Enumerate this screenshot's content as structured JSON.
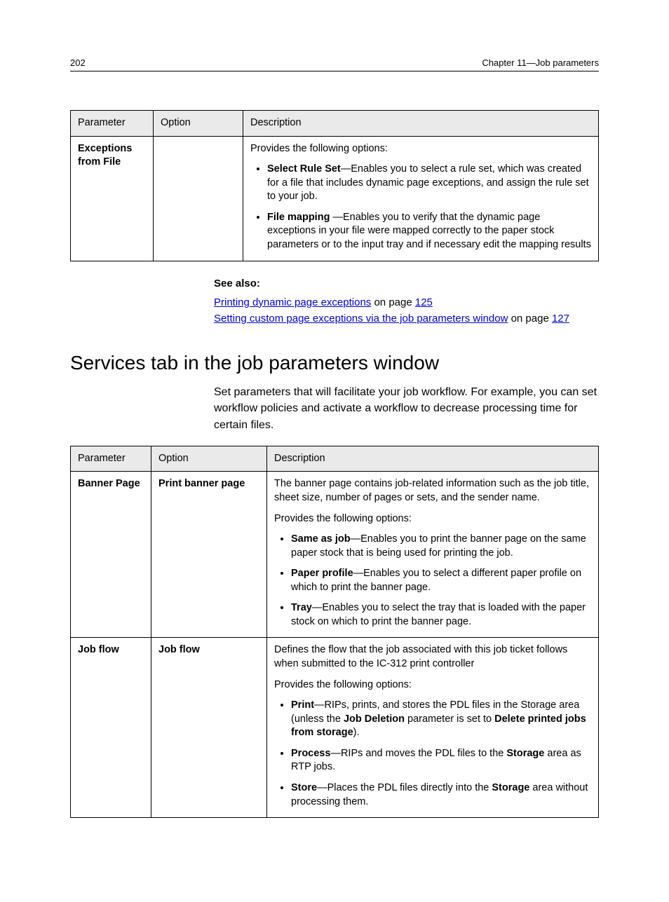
{
  "header": {
    "page_number": "202",
    "chapter": "Chapter 11—Job parameters"
  },
  "table1": {
    "headers": {
      "parameter": "Parameter",
      "option": "Option",
      "description": "Description"
    },
    "row": {
      "parameter": "Exceptions from File",
      "option": "",
      "desc_intro": "Provides the following options:",
      "bullets": [
        {
          "bold": "Select Rule Set",
          "rest": "—Enables you to select a rule set, which was created for a file that includes dynamic page exceptions, and assign the rule set to your job."
        },
        {
          "bold": "File mapping ",
          "rest": "—Enables you to verify that the dynamic page exceptions in your file were mapped correctly to the paper stock parameters or to the input tray and if necessary edit the mapping results"
        }
      ]
    }
  },
  "see_also": {
    "title": "See also:",
    "link1_text": "Printing dynamic page exceptions",
    "link1_suffix": " on page ",
    "link1_page": "125",
    "link2_text": "Setting custom page exceptions via the job parameters window",
    "link2_suffix": " on page ",
    "link2_page": "127"
  },
  "section": {
    "title": "Services tab in the job parameters window",
    "intro": "Set parameters that will facilitate your job workflow. For example, you can set workflow policies and activate a workflow to decrease processing time for certain files."
  },
  "table2": {
    "headers": {
      "parameter": "Parameter",
      "option": "Option",
      "description": "Description"
    },
    "rows": [
      {
        "parameter": "Banner Page",
        "option": "Print banner page",
        "desc_p1": "The banner page contains job-related information such as the job title, sheet size, number of pages or sets, and the sender name.",
        "desc_p2": "Provides the following options:",
        "bullets": [
          {
            "bold": "Same as job",
            "rest": "—Enables you to print the banner page on the same paper stock that is being used for printing the job."
          },
          {
            "bold": "Paper profile",
            "rest": "—Enables you to select a different paper profile on which to print the banner page."
          },
          {
            "bold": "Tray",
            "rest": "—Enables you to select the tray that is loaded with the paper stock on which to print the banner page."
          }
        ]
      },
      {
        "parameter": "Job flow",
        "option": "Job flow",
        "desc_p1": "Defines the flow that the job associated with this job ticket follows when submitted to the IC-312 print controller",
        "desc_p2": "Provides the following options:",
        "bullets": [
          {
            "bold": "Print",
            "rest_pre": "—RIPs, prints, and stores the PDL files in the Storage area (unless the ",
            "bold2": "Job Deletion",
            "rest_mid": " parameter is set to ",
            "bold3": "Delete printed jobs from storage",
            "rest_end": ")."
          },
          {
            "bold": "Process",
            "rest_pre": "—RIPs and moves the PDL files to the ",
            "bold2": "Storage",
            "rest_end": " area as RTP jobs."
          },
          {
            "bold": "Store",
            "rest_pre": "—Places the PDL files directly into the ",
            "bold2": "Storage",
            "rest_end": " area without processing them."
          }
        ]
      }
    ]
  }
}
